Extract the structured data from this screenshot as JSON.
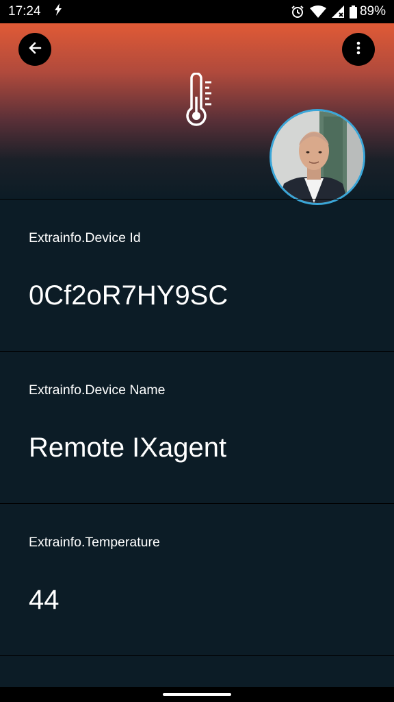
{
  "status_bar": {
    "time": "17:24",
    "battery": "89%"
  },
  "header": {
    "back_icon": "arrow-left-icon",
    "menu_icon": "more-vertical-icon",
    "device_icon": "thermometer-icon",
    "gradient_top": "#e05a36",
    "accent_ring": "#3aa6d8"
  },
  "fields": [
    {
      "label": "Extrainfo.Device Id",
      "value": "0Cf2oR7HY9SC"
    },
    {
      "label": "Extrainfo.Device Name",
      "value": "Remote IXagent"
    },
    {
      "label": "Extrainfo.Temperature",
      "value": "44"
    }
  ]
}
